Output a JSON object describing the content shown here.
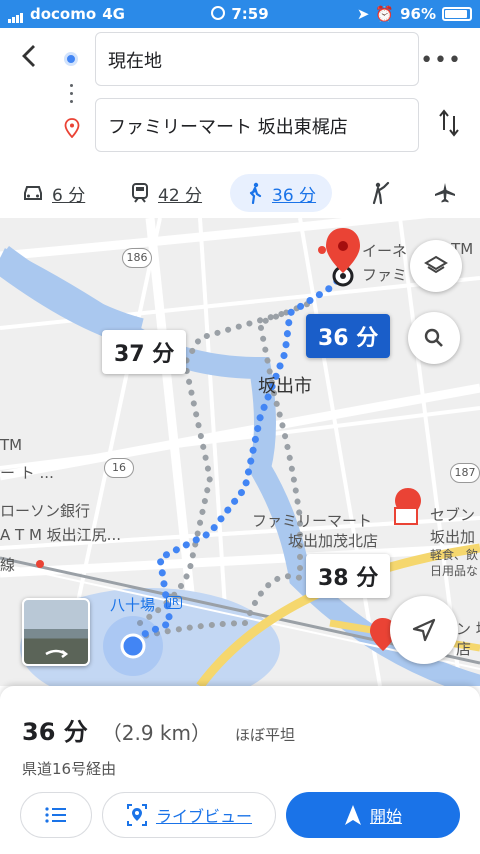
{
  "status_bar": {
    "carrier": "docomo",
    "network": "4G",
    "time": "7:59",
    "battery": "96%"
  },
  "directions": {
    "origin": "現在地",
    "destination": "ファミリーマート 坂出東梶店"
  },
  "modes": [
    {
      "icon": "car-icon",
      "label": "6 分"
    },
    {
      "icon": "train-icon",
      "label": "42 分"
    },
    {
      "icon": "walk-icon",
      "label": "36 分",
      "active": true
    },
    {
      "icon": "ride-icon",
      "label": ""
    },
    {
      "icon": "flight-icon",
      "label": ""
    }
  ],
  "map": {
    "city_label": "坂出市",
    "bubbles": {
      "alt1": "37 分",
      "selected": "36 分",
      "alt2": "38 分"
    },
    "labels": {
      "aeon": "イーネ",
      "atm": "ATM",
      "fami_top": "ファミ",
      "atm_left": "TM",
      "dash_left": "ー ト ...",
      "lawson1": "ローソン銀行",
      "lawson2": "A T M 坂出江尻...",
      "fami1": "ファミリーマート",
      "fami2": "坂出加茂北店",
      "seven1": "セブン",
      "seven2": "坂出加",
      "seven3": "軽食、飲",
      "seven4": "日用品な",
      "seven_bottom": "ン 坂",
      "seven_bottom2": "店",
      "station": "八十場",
      "station_jr": "JR",
      "sen": "線"
    },
    "route_numbers": {
      "r186": "186",
      "r16": "16",
      "r187": "187"
    }
  },
  "summary": {
    "time": "36 分",
    "distance": "（2.9 km）",
    "terrain": "ほぼ平坦",
    "via": "県道16号経由"
  },
  "buttons": {
    "list": "",
    "live_view": "ライブビュー",
    "start": "開始"
  },
  "colors": {
    "accent": "#1a73e8",
    "status_bar": "#2b8ae8",
    "route": "#4285f4",
    "water": "#aac8ef",
    "highway": "#f5d76e",
    "pin": "#ea4335"
  }
}
